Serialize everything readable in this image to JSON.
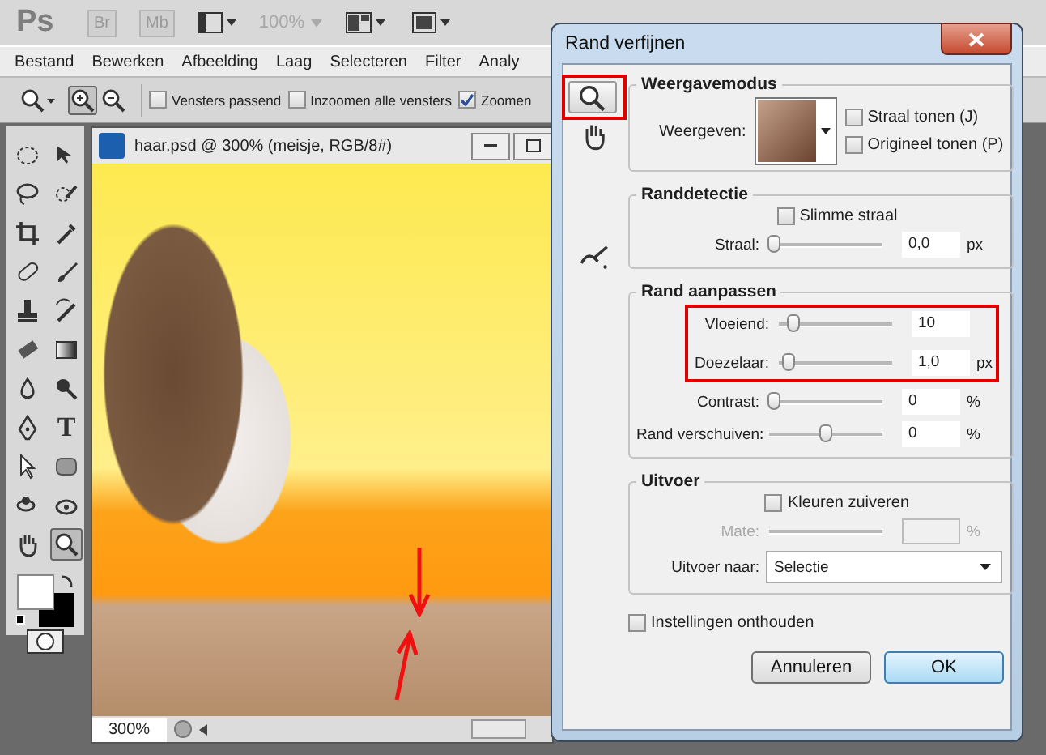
{
  "app": {
    "logo": "Ps",
    "bridge_buttons": [
      "Br",
      "Mb"
    ],
    "zoom_readout": "100%",
    "menu": [
      "Bestand",
      "Bewerken",
      "Afbeelding",
      "Laag",
      "Selecteren",
      "Filter",
      "Analy"
    ],
    "options": [
      {
        "label": "Vensters passend",
        "checked": false
      },
      {
        "label": "Inzoomen alle vensters",
        "checked": false
      },
      {
        "label": "Zoomen",
        "checked": true
      }
    ],
    "type_tool": "T",
    "document": {
      "title": "haar.psd @ 300% (meisje, RGB/8#)",
      "zoom": "300%",
      "annotation_arrows": true
    }
  },
  "dialog": {
    "title": "Rand verfijnen",
    "tools": [
      {
        "kind": "zoom",
        "selected": true,
        "highlighted": true
      },
      {
        "kind": "hand",
        "selected": false,
        "highlighted": false
      },
      {
        "kind": "brush",
        "selected": false,
        "highlighted": false
      }
    ],
    "groups": [
      {
        "title": "Weergavemodus",
        "rows": [
          {
            "kind": "view",
            "label": "Weergeven:",
            "checks": [
              {
                "label": "Straal tonen (J)",
                "checked": false
              },
              {
                "label": "Origineel tonen (P)",
                "checked": false
              }
            ]
          }
        ]
      },
      {
        "title": "Randdetectie",
        "rows": [
          {
            "kind": "check",
            "label": "Slimme straal",
            "checked": false
          },
          {
            "kind": "slider",
            "label": "Straal:",
            "level": 0,
            "value": "0,0",
            "unit": "px",
            "highlighted": false,
            "disabled": false
          }
        ]
      },
      {
        "title": "Rand aanpassen",
        "rows": [
          {
            "kind": "slider",
            "label": "Vloeiend:",
            "level": 0.1,
            "value": "10",
            "highlighted": true,
            "disabled": false
          },
          {
            "kind": "slider",
            "label": "Doezelaar:",
            "level": 0.05,
            "value": "1,0",
            "unit": "px",
            "highlighted": true,
            "disabled": false
          },
          {
            "kind": "slider",
            "label": "Contrast:",
            "level": 0,
            "value": "0",
            "unit": "%",
            "highlighted": false,
            "disabled": false
          },
          {
            "kind": "slider",
            "label": "Rand verschuiven:",
            "level": 0.5,
            "value": "0",
            "unit": "%",
            "highlighted": false,
            "disabled": false
          }
        ]
      },
      {
        "title": "Uitvoer",
        "rows": [
          {
            "kind": "check",
            "label": "Kleuren zuiveren",
            "checked": false
          },
          {
            "kind": "slider",
            "label": "Mate:",
            "unit": "%",
            "highlighted": false,
            "disabled": true
          },
          {
            "kind": "select",
            "label": "Uitvoer naar:",
            "value": "Selectie"
          }
        ]
      }
    ],
    "remember": {
      "label": "Instellingen onthouden",
      "checked": false
    },
    "buttons": [
      {
        "label": "Annuleren",
        "default": false
      },
      {
        "label": "OK",
        "default": true
      }
    ]
  }
}
